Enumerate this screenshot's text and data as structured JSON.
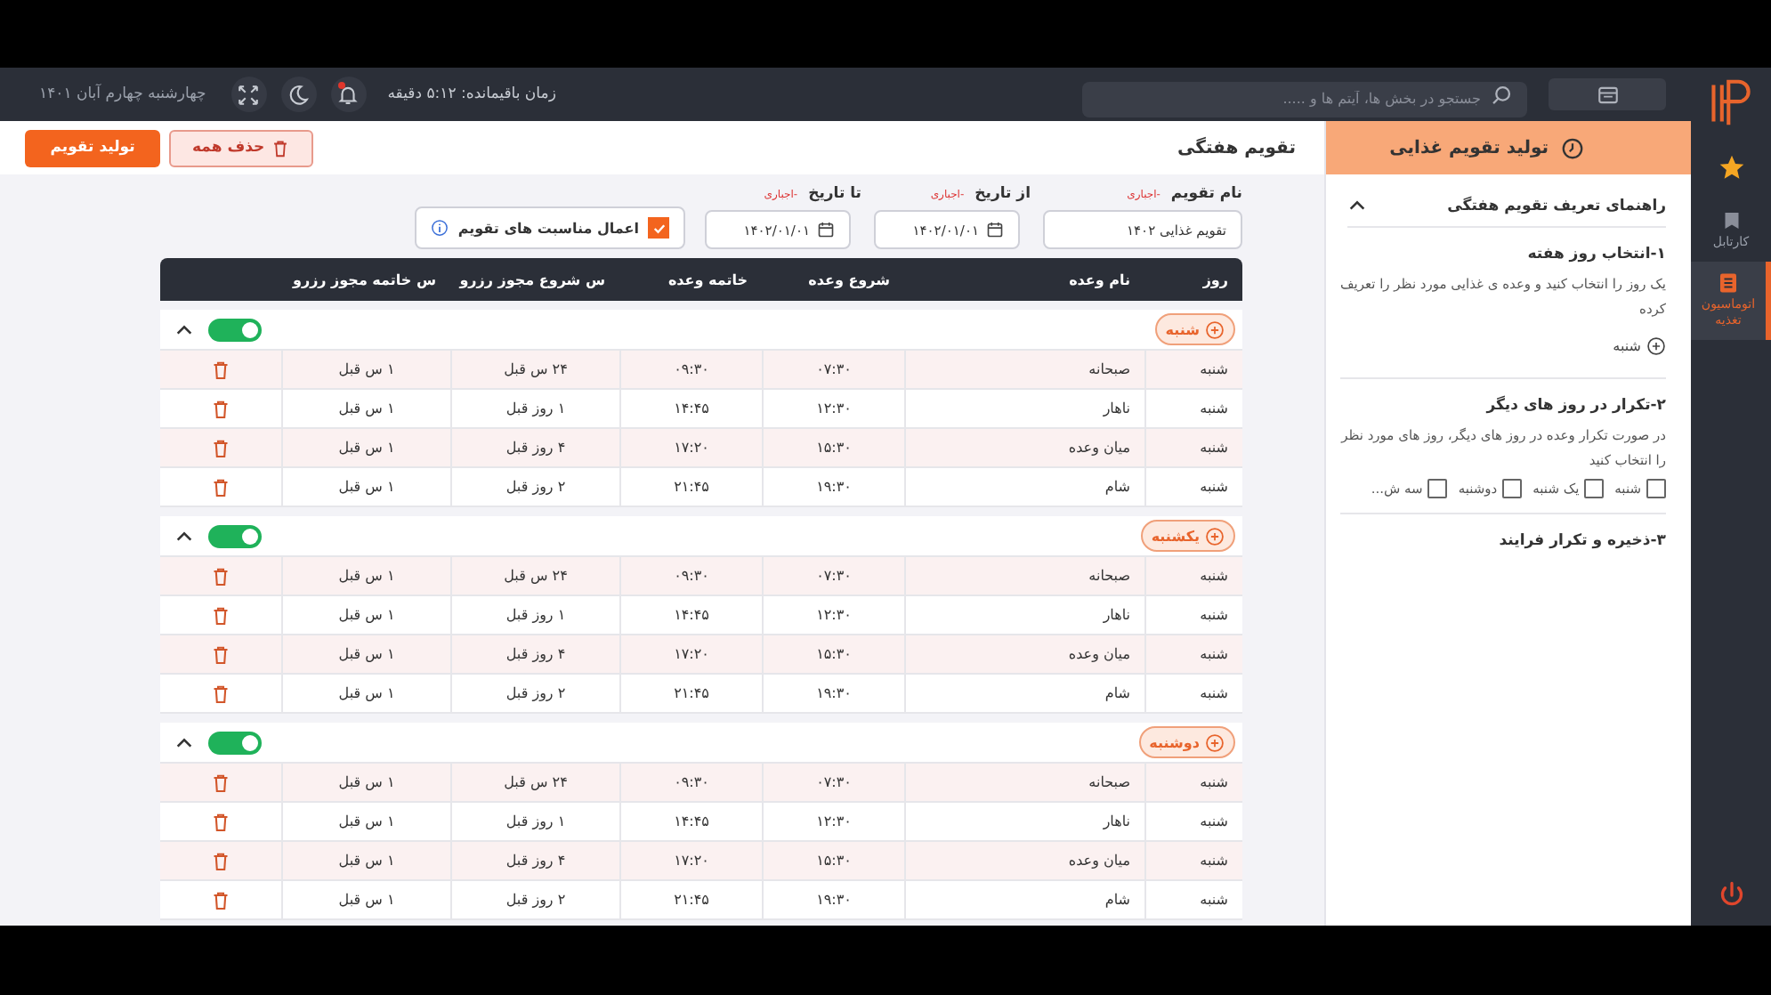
{
  "topbar": {
    "search": {
      "placeholder": "جستجو در بخش ها، آیتم ها و ....."
    },
    "remaining_time": "زمان باقیمانده: ۵:۱۲ دقیقه",
    "notification_unread": true,
    "date": "چهارشنبه چهارم آبان ۱۴۰۱"
  },
  "sidebar": {
    "items": [
      {
        "kind": "folder",
        "label": "کارتابل",
        "selected": false
      },
      {
        "kind": "list",
        "label": "اتوماسیون تغذیه",
        "selected": true
      }
    ]
  },
  "panel": {
    "title": "تولید تقویم غذایی",
    "guide": {
      "title": "راهنمای تعریف تقویم هفتگی",
      "expanded": true,
      "steps": [
        {
          "kind": "example",
          "title": "۱-انتخاب روز هفته",
          "text": "یک روز را انتخاب کنید و وعده ی غذایی مورد نظر را تعریف کرده",
          "example": "شنبه"
        },
        {
          "kind": "days",
          "title": "۲-تکرار در روز های دیگر",
          "text": "در صورت تکرار وعده در روز های دیگر، روز های مورد نظر را انتخاب کنید",
          "days": [
            {
              "label": "شنبه",
              "checked": false
            },
            {
              "label": "یک شنبه",
              "checked": false
            },
            {
              "label": "دوشنبه",
              "checked": false
            },
            {
              "label": "سه ش...",
              "checked": false
            }
          ]
        },
        {
          "kind": "plain",
          "title": "۳-ذخیره و تکرار فرایند"
        }
      ]
    }
  },
  "main": {
    "title": "تقویم هفتگی",
    "buttons": [
      {
        "kind": "danger",
        "label": "حذف همه"
      },
      {
        "kind": "primary",
        "label": "تولید تقویم"
      }
    ],
    "form": {
      "fields": [
        {
          "kind": "text",
          "label": "نام تقویم",
          "required": "-اجباری",
          "value": "تقویم غذایی ۱۴۰۲"
        },
        {
          "kind": "date",
          "label": "از تاریخ",
          "required": "-اجباری",
          "value": "۱۴۰۲/۰۱/۰۱"
        },
        {
          "kind": "date",
          "label": "تا تاریخ",
          "required": "-اجباری",
          "value": "۱۴۰۲/۰۱/۰۱"
        }
      ],
      "holidays": {
        "label": "اعمال مناسبت های تقویم",
        "checked": true
      }
    },
    "table": {
      "columns": [
        "روز",
        "نام وعده",
        "شروع وعده",
        "خاتمه وعده",
        "س شروع مجوز رزرو",
        "س خاتمه مجوز رزرو"
      ],
      "groups": [
        {
          "day": "شنبه",
          "on": true,
          "expanded": true,
          "rows": [
            {
              "cells": [
                "شنبه",
                "صبحانه",
                "۰۷:۳۰",
                "۰۹:۳۰",
                "۲۴ س قبل",
                "۱ س قبل"
              ]
            },
            {
              "cells": [
                "شنبه",
                "ناهار",
                "۱۲:۳۰",
                "۱۴:۴۵",
                "۱ روز قبل",
                "۱ س قبل"
              ]
            },
            {
              "cells": [
                "شنبه",
                "میان وعده",
                "۱۵:۳۰",
                "۱۷:۲۰",
                "۴ روز قبل",
                "۱ س قبل"
              ]
            },
            {
              "cells": [
                "شنبه",
                "شام",
                "۱۹:۳۰",
                "۲۱:۴۵",
                "۲ روز قبل",
                "۱ س قبل"
              ]
            }
          ]
        },
        {
          "day": "یکشنبه",
          "on": true,
          "expanded": true,
          "rows": [
            {
              "cells": [
                "شنبه",
                "صبحانه",
                "۰۷:۳۰",
                "۰۹:۳۰",
                "۲۴ س قبل",
                "۱ س قبل"
              ]
            },
            {
              "cells": [
                "شنبه",
                "ناهار",
                "۱۲:۳۰",
                "۱۴:۴۵",
                "۱ روز قبل",
                "۱ س قبل"
              ]
            },
            {
              "cells": [
                "شنبه",
                "میان وعده",
                "۱۵:۳۰",
                "۱۷:۲۰",
                "۴ روز قبل",
                "۱ س قبل"
              ]
            },
            {
              "cells": [
                "شنبه",
                "شام",
                "۱۹:۳۰",
                "۲۱:۴۵",
                "۲ روز قبل",
                "۱ س قبل"
              ]
            }
          ]
        },
        {
          "day": "دوشنبه",
          "on": true,
          "expanded": true,
          "rows": [
            {
              "cells": [
                "شنبه",
                "صبحانه",
                "۰۷:۳۰",
                "۰۹:۳۰",
                "۲۴ س قبل",
                "۱ س قبل"
              ]
            },
            {
              "cells": [
                "شنبه",
                "ناهار",
                "۱۲:۳۰",
                "۱۴:۴۵",
                "۱ روز قبل",
                "۱ س قبل"
              ]
            },
            {
              "cells": [
                "شنبه",
                "میان وعده",
                "۱۵:۳۰",
                "۱۷:۲۰",
                "۴ روز قبل",
                "۱ س قبل"
              ]
            },
            {
              "cells": [
                "شنبه",
                "شام",
                "۱۹:۳۰",
                "۲۱:۴۵",
                "۲ روز قبل",
                "۱ س قبل"
              ]
            }
          ]
        }
      ]
    }
  }
}
